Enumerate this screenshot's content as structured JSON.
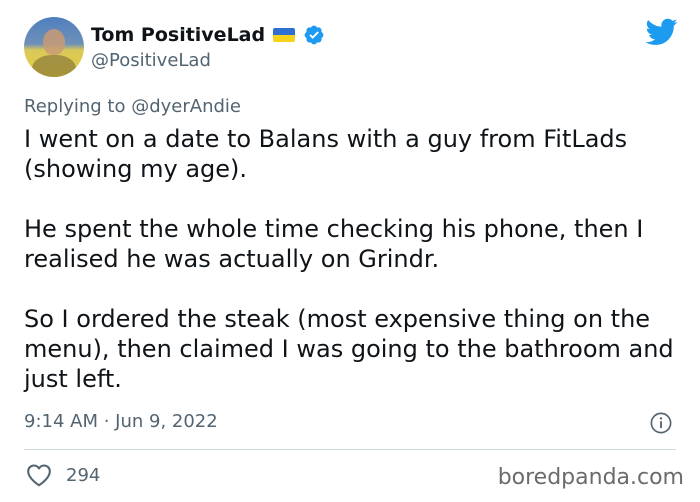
{
  "user": {
    "display_name": "Tom PositiveLad",
    "handle": "@PositiveLad",
    "flag_colors": [
      "#2f6fd1",
      "#f7d21a"
    ],
    "verified_color": "#1d9bf0",
    "avatar_icon": "user-avatar-photo"
  },
  "brand": {
    "icon": "twitter-bird-icon",
    "color": "#1d9bf0"
  },
  "tweet": {
    "replying_to": "Replying to @dyerAndie",
    "paragraphs": [
      "I went on a date to Balans with a guy from FitLads (showing my age).",
      "He spent the whole time checking his phone, then I realised he was actually on Grindr.",
      "So I ordered the steak (most expensive thing on the menu), then claimed I was going to the bathroom and just left."
    ],
    "timestamp": "9:14 AM · Jun 9, 2022",
    "likes": "294"
  },
  "watermark": "boredpanda.com"
}
